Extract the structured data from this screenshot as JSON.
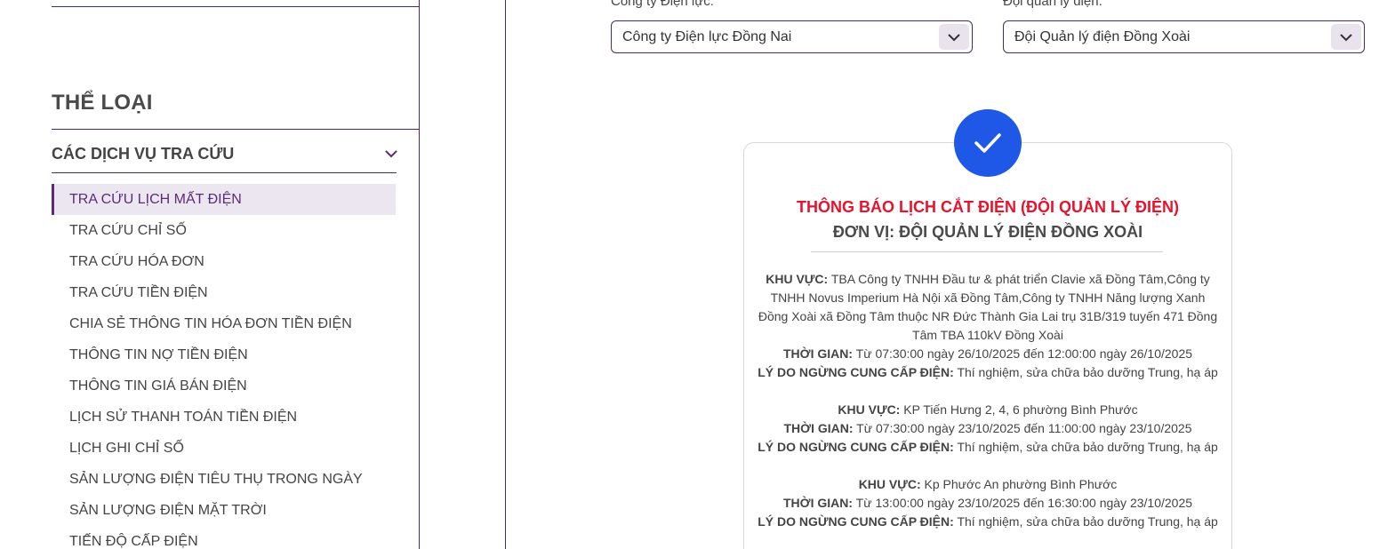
{
  "sidebar": {
    "category_title": "THỂ LOẠI",
    "group_label": "CÁC DỊCH VỤ TRA CỨU",
    "items": [
      {
        "label": "TRA CỨU LỊCH MẤT ĐIỆN",
        "active": true
      },
      {
        "label": "TRA CỨU CHỈ SỐ"
      },
      {
        "label": "TRA CỨU HÓA ĐƠN"
      },
      {
        "label": "TRA CỨU TIỀN ĐIỆN"
      },
      {
        "label": "CHIA SẺ THÔNG TIN HÓA ĐƠN TIỀN ĐIỆN"
      },
      {
        "label": "THÔNG TIN NỢ TIỀN ĐIỆN"
      },
      {
        "label": "THÔNG TIN GIÁ BÁN ĐIỆN"
      },
      {
        "label": "LỊCH SỬ THANH TOÁN TIỀN ĐIỆN"
      },
      {
        "label": "LỊCH GHI CHỈ SỐ"
      },
      {
        "label": "SẢN LƯỢNG ĐIỆN TIÊU THỤ TRONG NGÀY"
      },
      {
        "label": "SẢN LƯỢNG ĐIỆN MẶT TRỜI"
      },
      {
        "label": "TIẾN ĐỘ CẤP ĐIỆN"
      }
    ]
  },
  "filters": {
    "company_label": "Công ty Điện lực:",
    "company_value": "Công ty Điện lực Đồng Nai",
    "team_label": "Đội quản lý điện:",
    "team_value": "Đội Quản lý điện Đồng Xoài"
  },
  "result": {
    "title": "THÔNG BÁO LỊCH CẮT ĐIỆN (ĐỘI QUẢN LÝ ĐIỆN)",
    "unit": "ĐƠN VỊ: ĐỘI QUẢN LÝ ĐIỆN ĐỒNG XOÀI",
    "area_label": "KHU VỰC:",
    "time_label": "THỜI GIAN:",
    "reason_label": "LÝ DO NGỪNG CUNG CẤP ĐIỆN:",
    "entries": [
      {
        "area": "TBA Công ty TNHH Đầu tư & phát triển Clavie xã Đồng Tâm,Công ty TNHH Novus Imperium Hà Nội xã Đồng Tâm,Công ty TNHH Năng lượng Xanh Đồng Xoài xã Đồng Tâm thuộc NR Đức Thành Gia Lai trụ 31B/319 tuyến 471 Đồng Tâm TBA 110kV Đồng Xoài",
        "time": "Từ 07:30:00 ngày 26/10/2025 đến 12:00:00 ngày 26/10/2025",
        "reason": "Thí nghiệm, sửa chữa bảo dưỡng Trung, hạ áp"
      },
      {
        "area": "KP Tiến Hưng 2, 4, 6 phường Bình Phước",
        "time": "Từ 07:30:00 ngày 23/10/2025 đến 11:00:00 ngày 23/10/2025",
        "reason": "Thí nghiệm, sửa chữa bảo dưỡng Trung, hạ áp"
      },
      {
        "area": "Kp Phước An phường Bình Phước",
        "time": "Từ 13:00:00 ngày 23/10/2025 đến 16:30:00 ngày 23/10/2025",
        "reason": "Thí nghiệm, sửa chữa bảo dưỡng Trung, hạ áp"
      }
    ]
  }
}
